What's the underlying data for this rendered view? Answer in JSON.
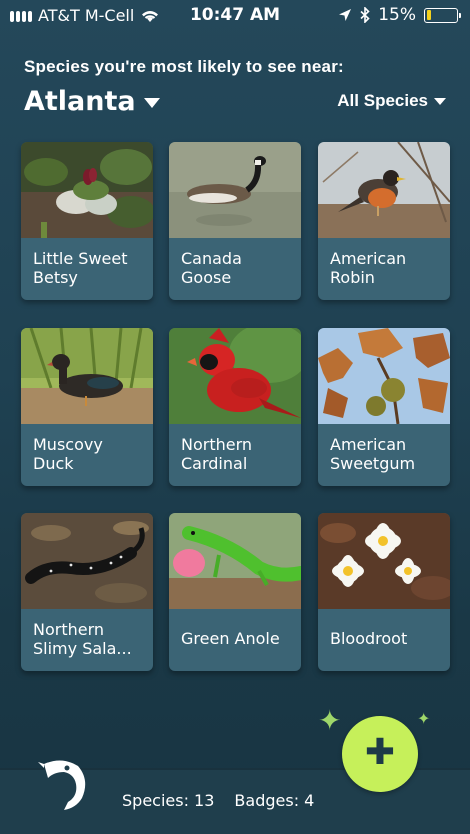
{
  "status_bar": {
    "carrier": "AT&T M-Cell",
    "time": "10:47 AM",
    "battery": "15%",
    "battery_level": 0.15
  },
  "header": {
    "subtitle": "Species you're most likely to see near:",
    "location": "Atlanta",
    "filter": "All Species"
  },
  "species": [
    {
      "name": "Little Sweet\nBetsy",
      "image": "trillium-photo"
    },
    {
      "name": "Canada\nGoose",
      "image": "goose-photo"
    },
    {
      "name": "American\nRobin",
      "image": "robin-photo"
    },
    {
      "name": "Muscovy\nDuck",
      "image": "duck-photo"
    },
    {
      "name": "Northern\nCardinal",
      "image": "cardinal-photo"
    },
    {
      "name": "American\nSweetgum",
      "image": "sweetgum-photo"
    },
    {
      "name": "Northern\nSlimy Sala...",
      "image": "salamander-photo"
    },
    {
      "name": "Green Anole",
      "image": "anole-photo"
    },
    {
      "name": "Bloodroot",
      "image": "bloodroot-photo"
    }
  ],
  "footer": {
    "species_count": "Species: 13",
    "badges_count": "Badges: 4",
    "add_icon": "plus-icon"
  },
  "colors": {
    "background": "#1f4152",
    "card": "#3b6475",
    "fab": "#c6f05a"
  }
}
